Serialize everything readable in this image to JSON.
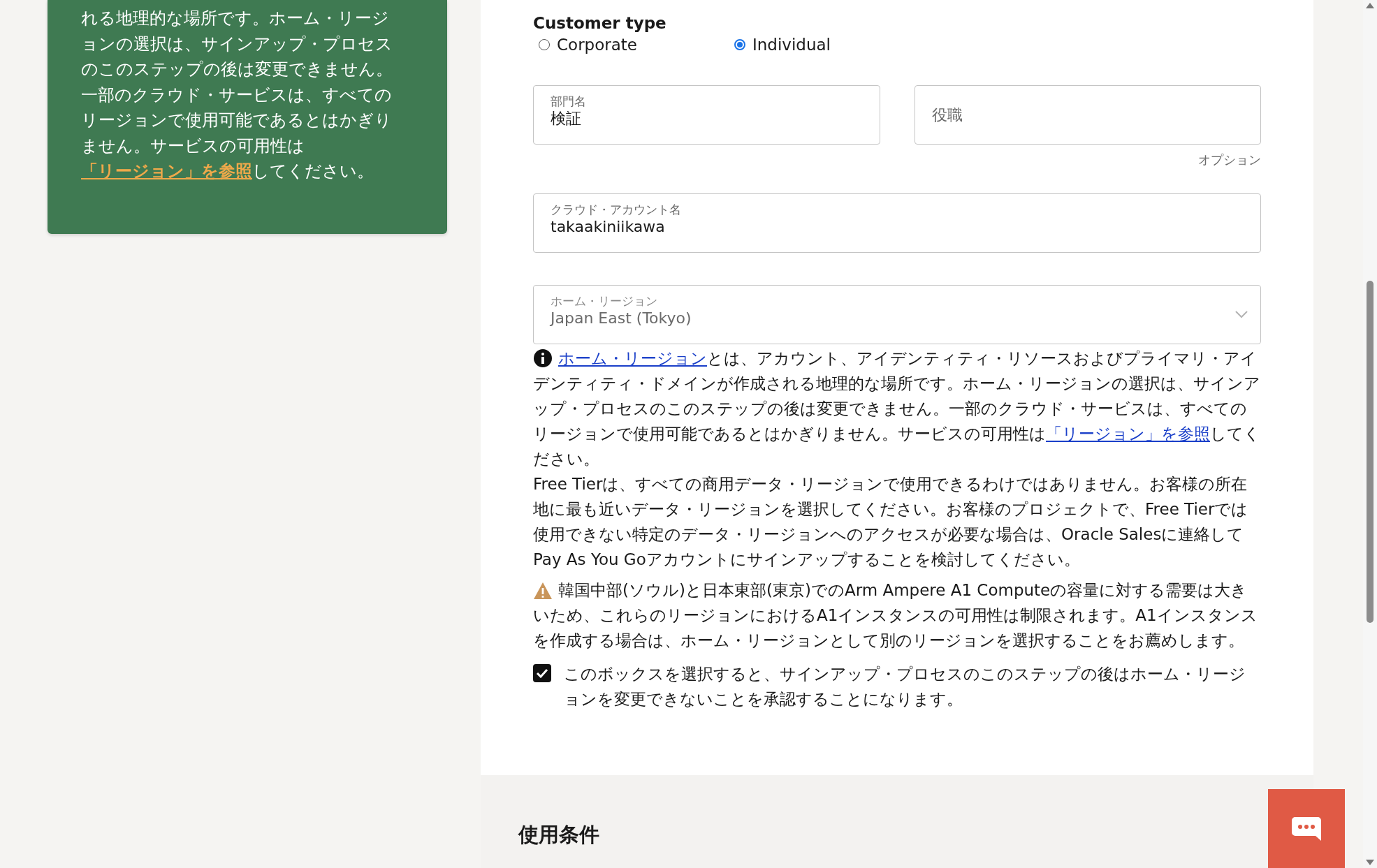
{
  "region_note_card": {
    "text_before": "れる地理的な場所です。ホーム・リージョンの選択は、サインアップ・プロセスのこのステップの後は変更できません。一部のクラウド・サービスは、すべてのリージョンで使用可能であるとはかぎりません。サービスの可用性は",
    "link": "「リージョン」を参照",
    "text_after": "してください。"
  },
  "customer_type": {
    "label": "Customer type",
    "options": [
      {
        "label": "Corporate",
        "selected": false
      },
      {
        "label": "Individual",
        "selected": true
      }
    ]
  },
  "department_field": {
    "label": "部門名",
    "value": "検証"
  },
  "job_title_field": {
    "placeholder": "役職",
    "hint": "オプション"
  },
  "account_name_field": {
    "label": "クラウド・アカウント名",
    "value": "takaakiniikawa"
  },
  "home_region_select": {
    "label": "ホーム・リージョン",
    "value": "Japan East (Tokyo)"
  },
  "region_info": {
    "link": "ホーム・リージョン",
    "text": "とは、アカウント、アイデンティティ・リソースおよびプライマリ・アイデンティティ・ドメインが作成される地理的な場所です。ホーム・リージョンの選択は、サインアップ・プロセスのこのステップの後は変更できません。一部のクラウド・サービスは、すべてのリージョンで使用可能であるとはかぎりません。サービスの可用性は",
    "link_2": "「リージョン」を参照",
    "text_2": "してください。"
  },
  "free_tier_note": "Free Tierは、すべての商用データ・リージョンで使用できるわけではありません。お客様の所在地に最も近いデータ・リージョンを選択してください。お客様のプロジェクトで、Free Tierでは使用できない特定のデータ・リージョンへのアクセスが必要な場合は、Oracle Salesに連絡してPay As You Goアカウントにサインアップすることを検討してください。",
  "capacity_warning": "韓国中部(ソウル)と日本東部(東京)でのArm Ampere A1 Computeの容量に対する需要は大きいため、これらのリージョンにおけるA1インスタンスの可用性は制限されます。A1インスタンスを作成する場合は、ホーム・リージョンとして別のリージョンを選択することをお薦めします。",
  "acknowledge_checkbox": {
    "checked": true,
    "label": "このボックスを選択すると、サインアップ・プロセスのこのステップの後はホーム・リージョンを変更できないことを承認することになります。"
  },
  "terms_section": {
    "heading": "使用条件"
  }
}
